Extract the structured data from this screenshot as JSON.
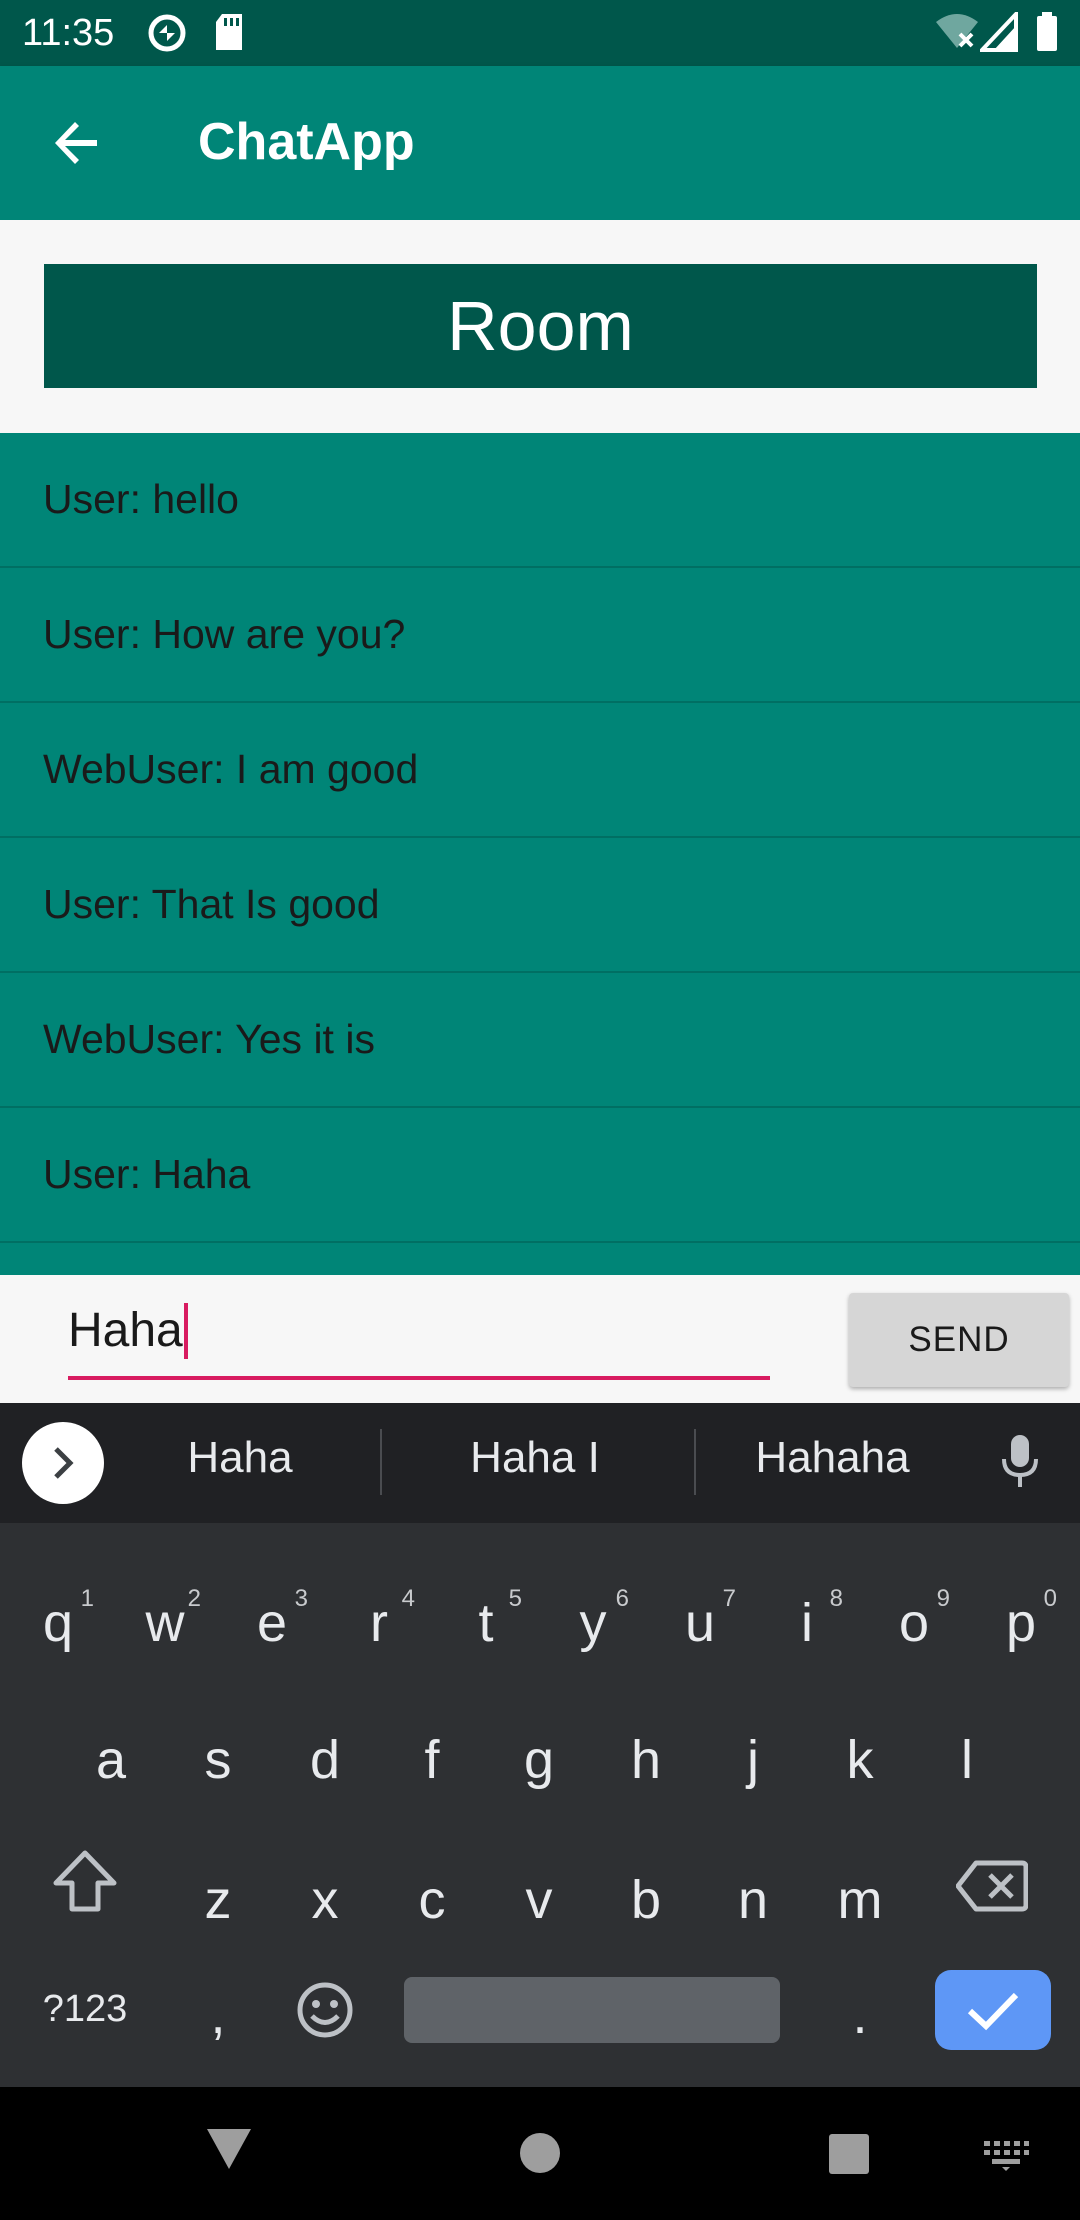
{
  "status_bar": {
    "time": "11:35",
    "icons": [
      "sync-icon",
      "sd-card-icon",
      "wifi-off-icon",
      "signal-icon",
      "battery-icon"
    ]
  },
  "app_bar": {
    "title": "ChatApp",
    "back_icon": "arrow-back-icon",
    "color": "#008577"
  },
  "room": {
    "title": "Room",
    "color": "#00574b"
  },
  "messages": [
    {
      "text": "User: hello"
    },
    {
      "text": "User: How are you?"
    },
    {
      "text": "WebUser: I am good"
    },
    {
      "text": "User: That Is good"
    },
    {
      "text": "WebUser: Yes it is"
    },
    {
      "text": "User: Haha"
    }
  ],
  "composer": {
    "value": "Haha",
    "send_label": "SEND",
    "accent": "#d81b60"
  },
  "keyboard": {
    "suggestions": [
      "Haha",
      "Haha I",
      "Hahaha"
    ],
    "row1": [
      "q",
      "w",
      "e",
      "r",
      "t",
      "y",
      "u",
      "i",
      "o",
      "p"
    ],
    "row1_hints": [
      "1",
      "2",
      "3",
      "4",
      "5",
      "6",
      "7",
      "8",
      "9",
      "0"
    ],
    "row2": [
      "a",
      "s",
      "d",
      "f",
      "g",
      "h",
      "j",
      "k",
      "l"
    ],
    "row3": [
      "z",
      "x",
      "c",
      "v",
      "b",
      "n",
      "m"
    ],
    "symbols_label": "?123",
    "comma": ",",
    "period": ".",
    "enter_color": "#5e97f6"
  },
  "nav_bar": {
    "icons": [
      "back-triangle-icon",
      "home-circle-icon",
      "recents-square-icon",
      "keyboard-switch-icon"
    ]
  }
}
